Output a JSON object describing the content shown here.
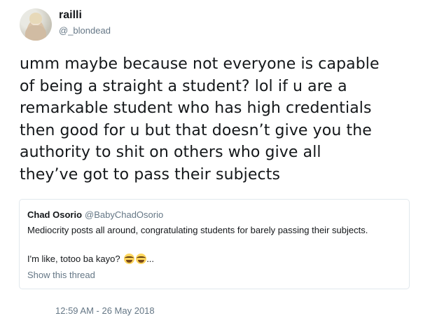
{
  "author": {
    "name": "railli",
    "handle": "@_blondead",
    "avatar_icon": "user-avatar"
  },
  "tweet": {
    "lines": [
      "umm maybe because not everyone is capable",
      "of being a straight a student? lol if u are a",
      "remarkable student who has high credentials",
      "then good for u but that doesn’t give you the",
      "authority to shit on others who give all",
      "they’ve got to pass their subjects"
    ]
  },
  "quoted_tweet": {
    "name": "Chad Osorio",
    "handle": "@BabyChadOsorio",
    "text_line1": "Mediocrity posts all around, congratulating students for barely passing their subjects.",
    "text_line2": "I'm like, totoo ba kayo?",
    "emoji_icon": "face-with-tears-of-joy-icon",
    "ellipsis": "...",
    "show_thread_label": "Show this thread"
  },
  "timestamp": "12:59 AM - 26 May 2018",
  "colors": {
    "text": "#14171a",
    "secondary": "#657786",
    "border": "#e1e8ed"
  }
}
